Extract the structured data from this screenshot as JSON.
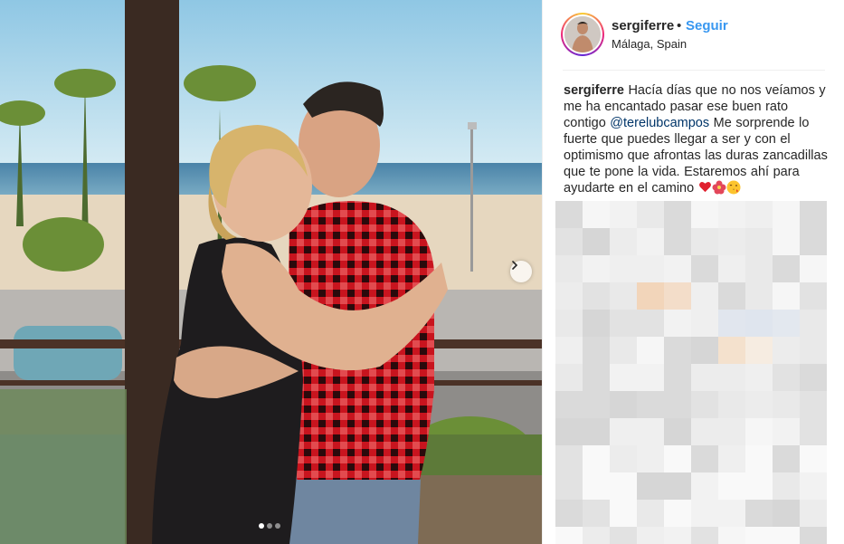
{
  "post": {
    "username": "sergiferre",
    "separator": "•",
    "follow_label": "Seguir",
    "location": "Málaga, Spain",
    "caption": {
      "username": "sergiferre",
      "text_before": "Hacía días que no nos veíamos y me ha encantado pasar ese buen rato contigo",
      "mention": "@terelubcampos",
      "text_after": "Me sorprende lo fuerte que puedes llegar a ser y con el optimismo que afrontas las duras zancadillas que te pone la vida. Estaremos ahí para ayudarte en el camino"
    },
    "caption_emojis": [
      "red-heart",
      "hibiscus-flower",
      "face-blowing-kiss"
    ]
  },
  "carousel": {
    "total_slides": 3,
    "active_slide": 1,
    "next_icon": "chevron-right-icon"
  },
  "colors": {
    "link": "#3897f0",
    "mention": "#003569",
    "text": "#262626"
  }
}
